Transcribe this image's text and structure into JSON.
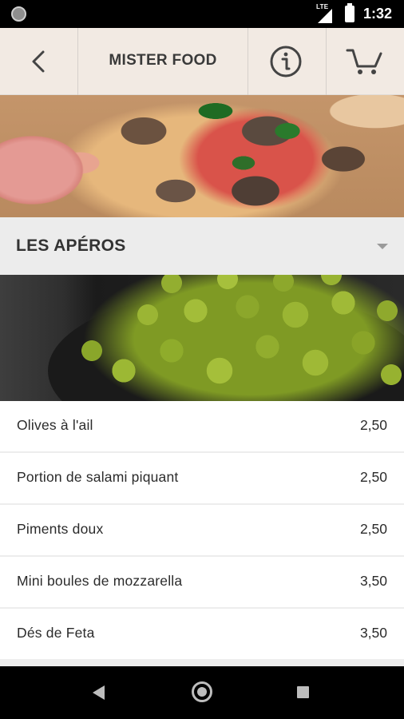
{
  "status_bar": {
    "network": "LTE",
    "time": "1:32",
    "icons": [
      "notification-dot-icon",
      "signal-icon",
      "battery-icon"
    ]
  },
  "header": {
    "title": "MISTER FOOD",
    "icons": [
      "back-icon",
      "info-icon",
      "cart-icon"
    ]
  },
  "category": {
    "label": "LES APÉROS",
    "icon": "chevron-down-icon"
  },
  "menu_items": [
    {
      "name": "Olives à l'ail",
      "price": "2,50"
    },
    {
      "name": "Portion de salami piquant",
      "price": "2,50"
    },
    {
      "name": "Piments doux",
      "price": "2,50"
    },
    {
      "name": "Mini boules de mozzarella",
      "price": "3,50"
    },
    {
      "name": "Dés de Feta",
      "price": "3,50"
    }
  ],
  "nav_bar": {
    "icons": [
      "nav-back-icon",
      "nav-home-icon",
      "nav-recents-icon"
    ]
  },
  "colors": {
    "topbar_bg": "#f5f0ec",
    "category_bg": "#ececec",
    "text": "#2b2b2b"
  }
}
